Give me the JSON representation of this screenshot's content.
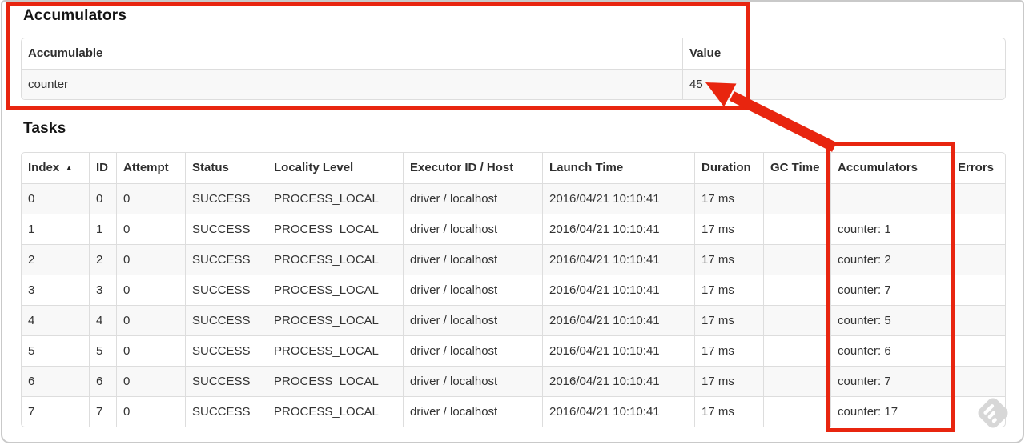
{
  "annotations": {
    "color": "#e8250f",
    "highlight_value": "45",
    "highlighted_column": "Accumulators"
  },
  "accumulators_section": {
    "title": "Accumulators",
    "table": {
      "columns": [
        "Accumulable",
        "Value"
      ],
      "rows": [
        [
          "counter",
          "45"
        ]
      ]
    }
  },
  "tasks_section": {
    "title": "Tasks",
    "table": {
      "columns": [
        "Index",
        "ID",
        "Attempt",
        "Status",
        "Locality Level",
        "Executor ID / Host",
        "Launch Time",
        "Duration",
        "GC Time",
        "Accumulators",
        "Errors"
      ],
      "sort_column": "Index",
      "sort_indicator": "▲",
      "rows": [
        [
          "0",
          "0",
          "0",
          "SUCCESS",
          "PROCESS_LOCAL",
          "driver / localhost",
          "2016/04/21 10:10:41",
          "17 ms",
          "",
          "",
          ""
        ],
        [
          "1",
          "1",
          "0",
          "SUCCESS",
          "PROCESS_LOCAL",
          "driver / localhost",
          "2016/04/21 10:10:41",
          "17 ms",
          "",
          "counter: 1",
          ""
        ],
        [
          "2",
          "2",
          "0",
          "SUCCESS",
          "PROCESS_LOCAL",
          "driver / localhost",
          "2016/04/21 10:10:41",
          "17 ms",
          "",
          "counter: 2",
          ""
        ],
        [
          "3",
          "3",
          "0",
          "SUCCESS",
          "PROCESS_LOCAL",
          "driver / localhost",
          "2016/04/21 10:10:41",
          "17 ms",
          "",
          "counter: 7",
          ""
        ],
        [
          "4",
          "4",
          "0",
          "SUCCESS",
          "PROCESS_LOCAL",
          "driver / localhost",
          "2016/04/21 10:10:41",
          "17 ms",
          "",
          "counter: 5",
          ""
        ],
        [
          "5",
          "5",
          "0",
          "SUCCESS",
          "PROCESS_LOCAL",
          "driver / localhost",
          "2016/04/21 10:10:41",
          "17 ms",
          "",
          "counter: 6",
          ""
        ],
        [
          "6",
          "6",
          "0",
          "SUCCESS",
          "PROCESS_LOCAL",
          "driver / localhost",
          "2016/04/21 10:10:41",
          "17 ms",
          "",
          "counter: 7",
          ""
        ],
        [
          "7",
          "7",
          "0",
          "SUCCESS",
          "PROCESS_LOCAL",
          "driver / localhost",
          "2016/04/21 10:10:41",
          "17 ms",
          "",
          "counter: 17",
          ""
        ]
      ]
    }
  },
  "watermark": {
    "icon": "feedly-logo"
  }
}
